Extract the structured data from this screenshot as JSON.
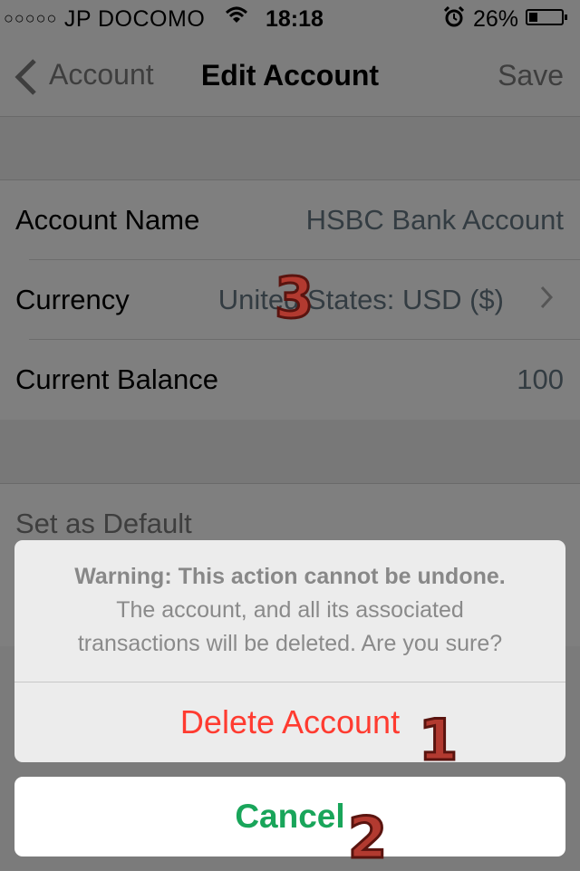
{
  "status_bar": {
    "signal_dots": "○○○○○",
    "carrier": "JP DOCOMO",
    "time": "18:18",
    "battery": "26%",
    "battery_level": 0.26,
    "icons": [
      "wifi-icon",
      "alarm-clock-icon",
      "battery-icon"
    ]
  },
  "nav": {
    "back_label": "Account",
    "title": "Edit Account",
    "save_label": "Save"
  },
  "form": {
    "rows": [
      {
        "label": "Account Name",
        "value": "HSBC Bank Account"
      },
      {
        "label": "Currency",
        "value": "United States: USD ($)"
      },
      {
        "label": "Current Balance",
        "value": "100"
      }
    ],
    "default_label": "Set as Default"
  },
  "action_sheet": {
    "warning_title": "Warning: This action cannot be undone.",
    "warning_line2": "The account, and all its associated",
    "warning_line3": "transactions will be deleted. Are you sure?",
    "delete_label": "Delete Account",
    "cancel_label": "Cancel"
  },
  "annotations": {
    "marker1": "1",
    "marker2": "2",
    "marker3": "3"
  },
  "colors": {
    "destructive": "#ff3b30",
    "cancel": "#19a55a",
    "marker": "#b23a30"
  }
}
